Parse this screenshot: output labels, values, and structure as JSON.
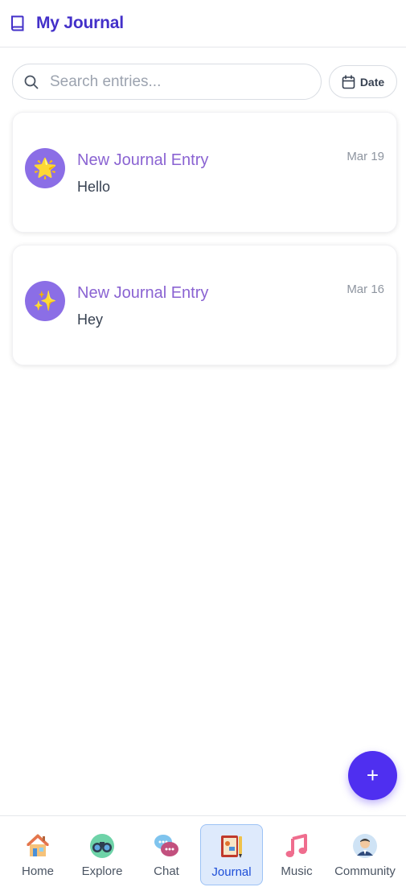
{
  "header": {
    "title": "My Journal",
    "icon": "book-icon"
  },
  "search": {
    "placeholder": "Search entries...",
    "value": ""
  },
  "date_button": {
    "label": "Date",
    "icon": "calendar-icon"
  },
  "entries": [
    {
      "title": "New Journal Entry",
      "body": "Hello",
      "date": "Mar 19",
      "emoji": "🌟"
    },
    {
      "title": "New Journal Entry",
      "body": "Hey",
      "date": "Mar 16",
      "emoji": "✨"
    }
  ],
  "fab": {
    "label": "+",
    "icon": "plus-icon"
  },
  "nav": {
    "items": [
      {
        "label": "Home",
        "icon": "house-icon"
      },
      {
        "label": "Explore",
        "icon": "binoculars-icon"
      },
      {
        "label": "Chat",
        "icon": "chat-bubbles-icon"
      },
      {
        "label": "Journal",
        "icon": "notebook-icon",
        "active": true
      },
      {
        "label": "Music",
        "icon": "music-note-icon"
      },
      {
        "label": "Community",
        "icon": "person-avatar-icon"
      }
    ]
  },
  "colors": {
    "accent": "#4330c9",
    "fab": "#4f2ff0",
    "entry_title": "#8a63d2",
    "avatar_bg": "#8b6ee6",
    "active_nav_bg": "#deeafc"
  }
}
